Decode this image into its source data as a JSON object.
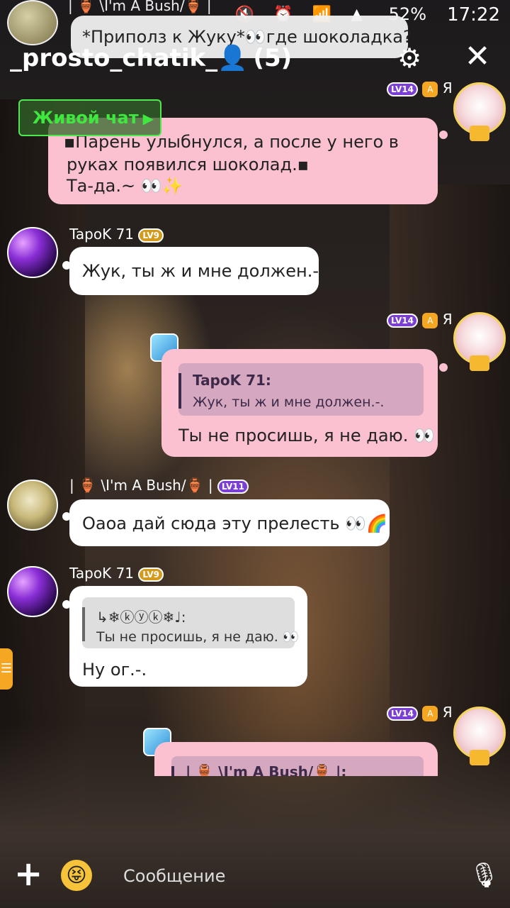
{
  "status": {
    "time": "17:22",
    "battery": "52%",
    "icons": "🔇 ⏰ 📶 ▲"
  },
  "header": {
    "title": "_prosto_chatik_",
    "title_emoji": "👤",
    "count": "(5)"
  },
  "top_message": {
    "author": "| 🏺 \\I'm A Bush/🏺 |",
    "text": "*Приполз к Жуку*👀где шоколадка?"
  },
  "live_chat": {
    "label": "Живой чат",
    "arrow": "▶"
  },
  "messages": [
    {
      "author": "Я",
      "level": "LV14",
      "lines": [
        "▪Парень улыбнулся, а после у него в",
        "руках появился шоколад.▪",
        "Та-да.~ 👀✨"
      ]
    },
    {
      "author": "TapoK 71",
      "level": "LV9",
      "text": "Жук, ты ж и мне должен.-."
    },
    {
      "author": "Я",
      "level": "LV14",
      "quote_author": "TapoK 71:",
      "quote_text": "Жук, ты ж и мне должен.-.",
      "text": "Ты не просишь, я не даю. 👀"
    },
    {
      "author": "| 🏺 \\I'm A Bush/🏺 |",
      "level": "LV11",
      "text": "Оаоа дай сюда эту прелесть 👀🌈"
    },
    {
      "author": "TapoK 71",
      "level": "LV9",
      "quote_author": "↳❄ⓚⓨⓚ❄♩:",
      "quote_text": "Ты не просишь, я не даю. 👀",
      "text": "Ну ог.-."
    },
    {
      "author": "Я",
      "level": "LV14",
      "quote_author": "| 🏺 \\I'm A Bush/🏺 |:"
    }
  ],
  "composer": {
    "placeholder": "Сообщение",
    "plus": "+",
    "emoji": "😝",
    "mic": "🎙"
  },
  "icons": {
    "gear": "⚙",
    "close": "✕",
    "menu": "☰",
    "rank": "A"
  }
}
